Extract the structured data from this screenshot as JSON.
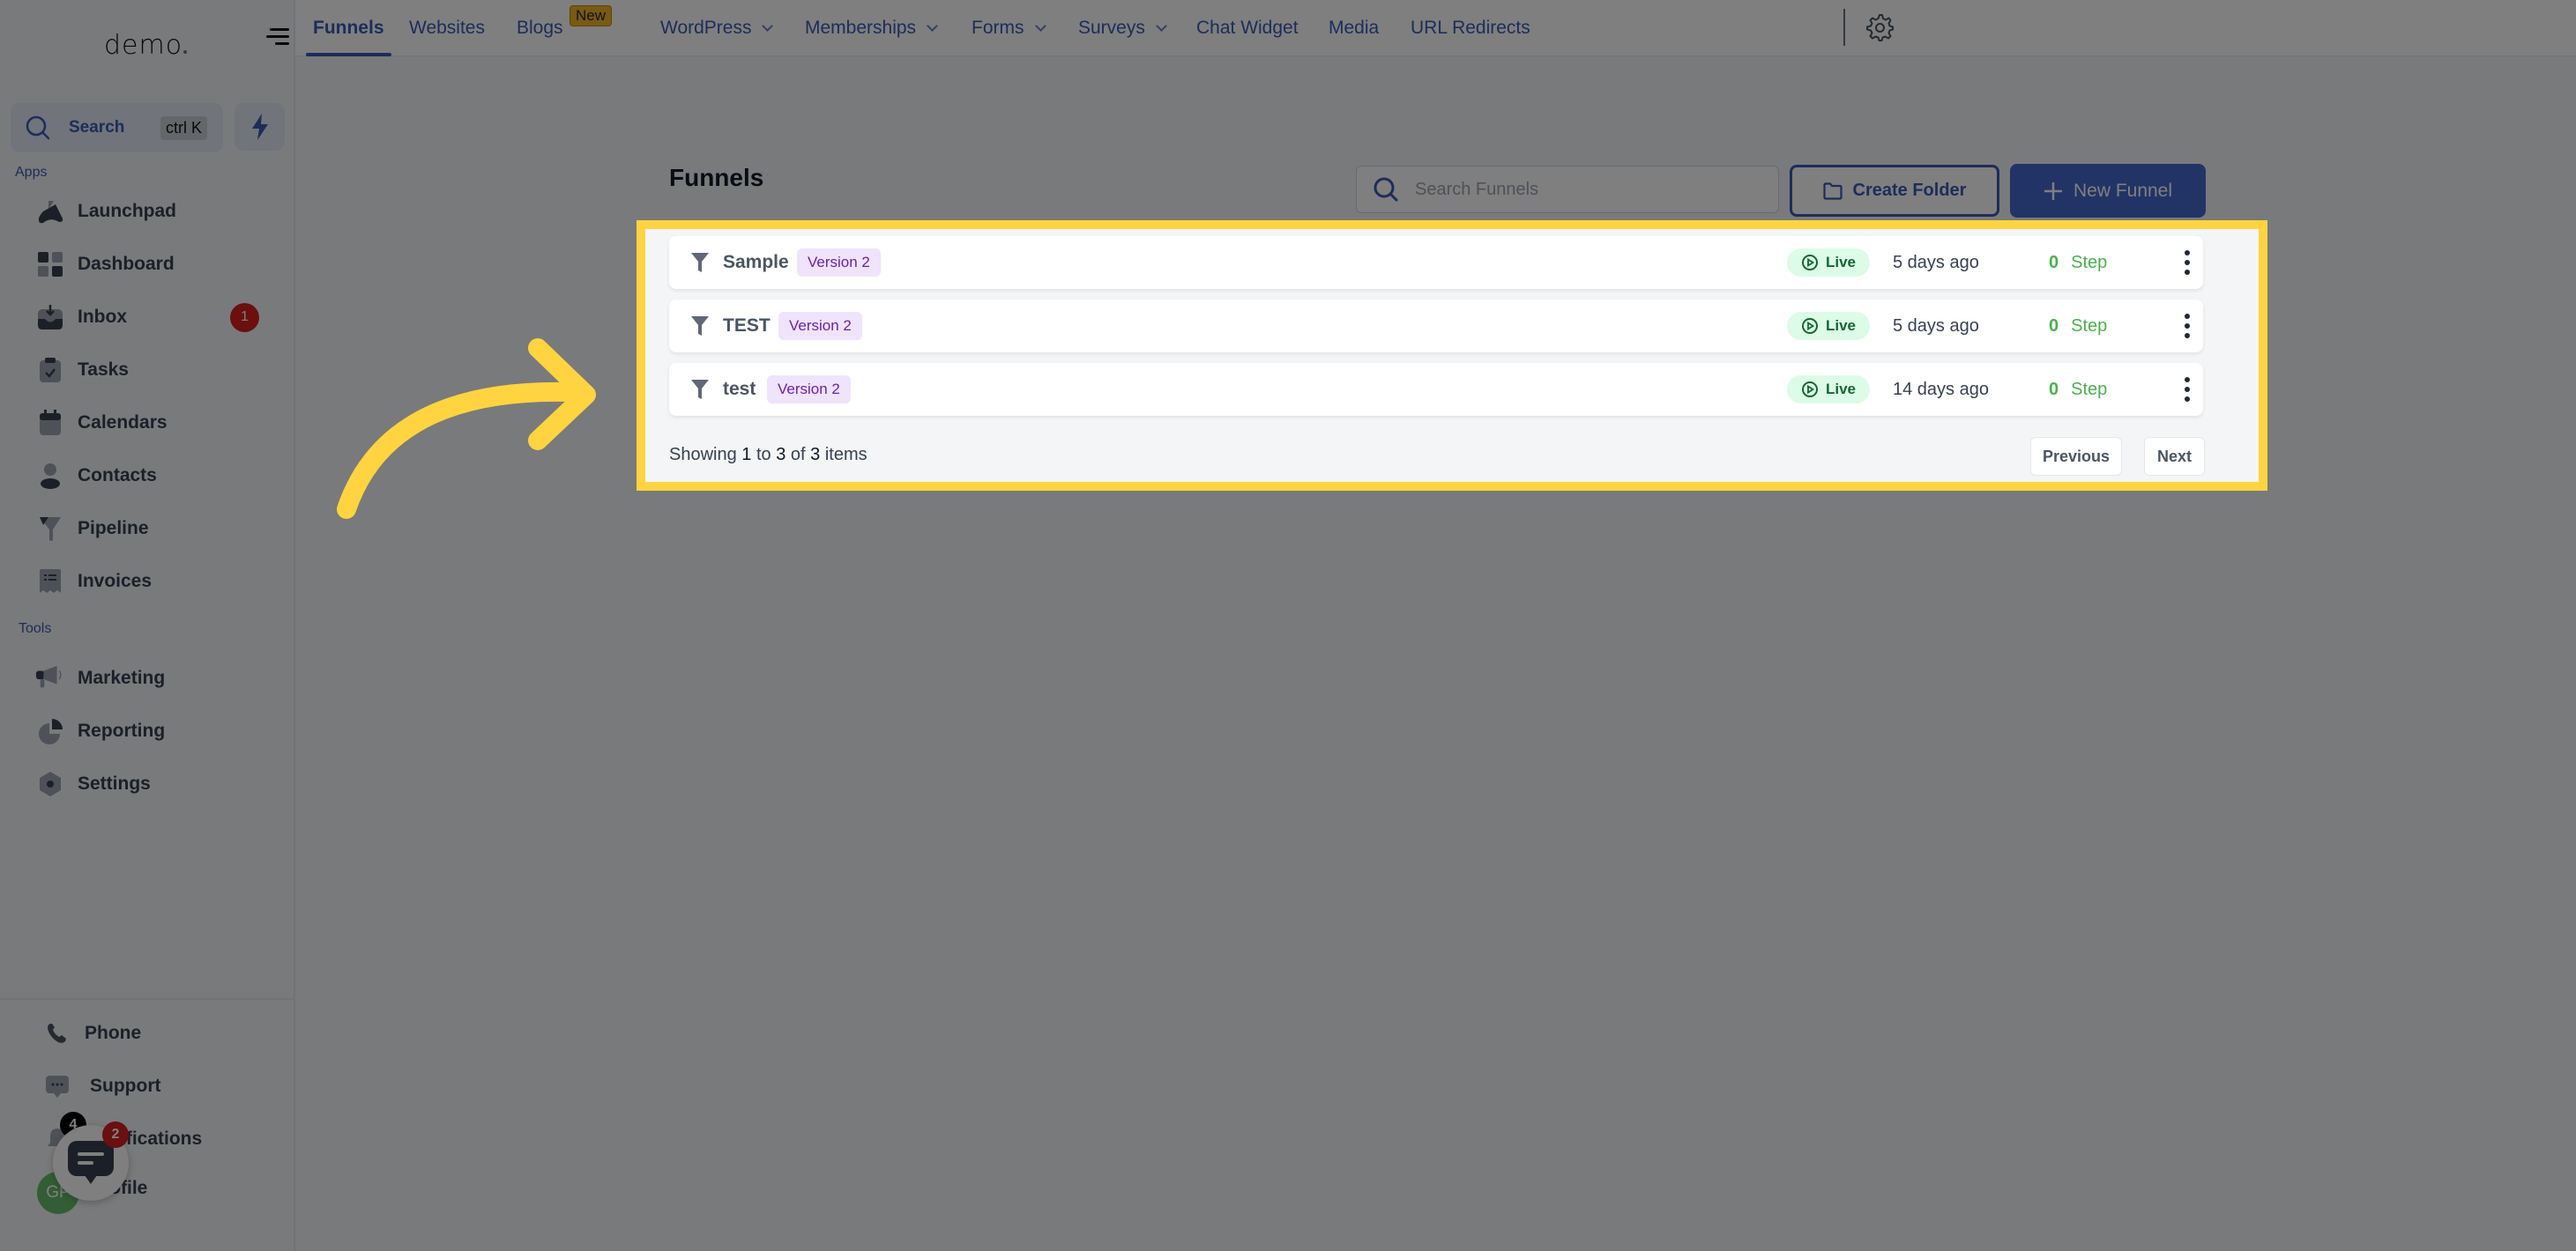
{
  "sidebar": {
    "logo": "demo",
    "search": {
      "label": "Search",
      "shortcut": "ctrl K"
    },
    "sections": {
      "apps": "Apps",
      "tools": "Tools"
    },
    "apps": [
      {
        "label": "Launchpad",
        "icon": "launchpad-icon"
      },
      {
        "label": "Dashboard",
        "icon": "dashboard-icon"
      },
      {
        "label": "Inbox",
        "icon": "inbox-icon",
        "badge": "1"
      },
      {
        "label": "Tasks",
        "icon": "tasks-icon"
      },
      {
        "label": "Calendars",
        "icon": "calendar-icon"
      },
      {
        "label": "Contacts",
        "icon": "contacts-icon"
      },
      {
        "label": "Pipeline",
        "icon": "pipeline-icon"
      },
      {
        "label": "Invoices",
        "icon": "invoices-icon"
      }
    ],
    "tools": [
      {
        "label": "Marketing",
        "icon": "megaphone-icon"
      },
      {
        "label": "Reporting",
        "icon": "pie-chart-icon"
      },
      {
        "label": "Settings",
        "icon": "settings-icon"
      }
    ],
    "bottom": [
      {
        "label": "Phone",
        "icon": "phone-icon"
      },
      {
        "label": "Support",
        "icon": "support-chat-icon"
      },
      {
        "label": "Notifications",
        "icon": "bell-icon",
        "badge": "4"
      },
      {
        "label": "Profile",
        "avatar_initials": "GP"
      }
    ]
  },
  "chat_widget": {
    "badge": "2"
  },
  "topnav": {
    "tabs": [
      {
        "label": "Funnels",
        "active": true
      },
      {
        "label": "Websites"
      },
      {
        "label": "Blogs",
        "badge": "New"
      },
      {
        "label": "WordPress",
        "dropdown": true
      },
      {
        "label": "Memberships",
        "dropdown": true
      },
      {
        "label": "Forms",
        "dropdown": true
      },
      {
        "label": "Surveys",
        "dropdown": true
      },
      {
        "label": "Chat Widget"
      },
      {
        "label": "Media"
      },
      {
        "label": "URL Redirects"
      }
    ]
  },
  "main": {
    "title": "Funnels",
    "search_placeholder": "Search Funnels",
    "create_folder_label": "Create Folder",
    "new_funnel_label": "New Funnel",
    "funnels": [
      {
        "name": "Sample",
        "version": "Version 2",
        "status": "Live",
        "updated": "5 days ago",
        "steps": "0",
        "steps_label": "Step"
      },
      {
        "name": "TEST",
        "version": "Version 2",
        "status": "Live",
        "updated": "5 days ago",
        "steps": "0",
        "steps_label": "Step"
      },
      {
        "name": "test",
        "version": "Version 2",
        "status": "Live",
        "updated": "14 days ago",
        "steps": "0",
        "steps_label": "Step"
      }
    ],
    "pagination": {
      "prefix": "Showing",
      "from": "1",
      "to_word": "to",
      "to": "3",
      "of_word": "of",
      "total": "3",
      "suffix": "items",
      "previous_label": "Previous",
      "next_label": "Next"
    }
  },
  "colors": {
    "accent": "#3b5bb5",
    "highlight": "#ffd440",
    "live_bg": "#dcfce7",
    "live_text": "#166534",
    "version_bg": "#efe4fb",
    "version_text": "#6b21a8",
    "step_green": "#4caf50",
    "badge_red": "#d61f1f"
  }
}
